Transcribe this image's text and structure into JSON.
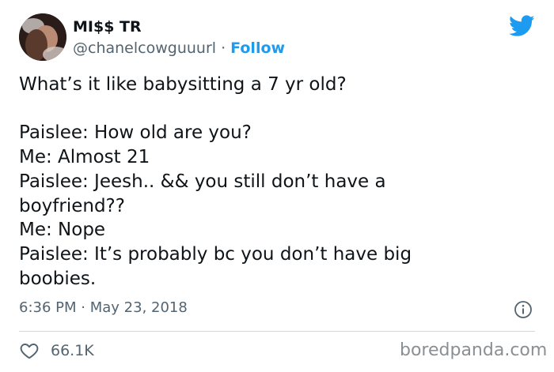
{
  "user": {
    "display_name": "MI$$ TR",
    "handle": "@chanelcowguuurl",
    "separator": "·",
    "follow_label": "Follow"
  },
  "tweet": {
    "lines": [
      "What’s it like babysitting a 7 yr old?",
      "",
      "Paislee: How old are you?",
      "Me: Almost 21",
      "Paislee: Jeesh.. && you still don’t have a",
      "boyfriend??",
      "Me: Nope",
      "Paislee: It’s probably bc you don’t have big",
      "boobies."
    ],
    "time": "6:36 PM",
    "date": "May 23, 2018",
    "meta_separator": "·"
  },
  "engagement": {
    "likes": "66.1K"
  },
  "watermark": "boredpanda.com",
  "icons": {
    "logo": "twitter-bird-icon",
    "info": "info-icon",
    "like": "heart-icon"
  },
  "colors": {
    "accent": "#1d9bf0",
    "secondary_text": "#536471",
    "divider": "#cfd9de"
  }
}
